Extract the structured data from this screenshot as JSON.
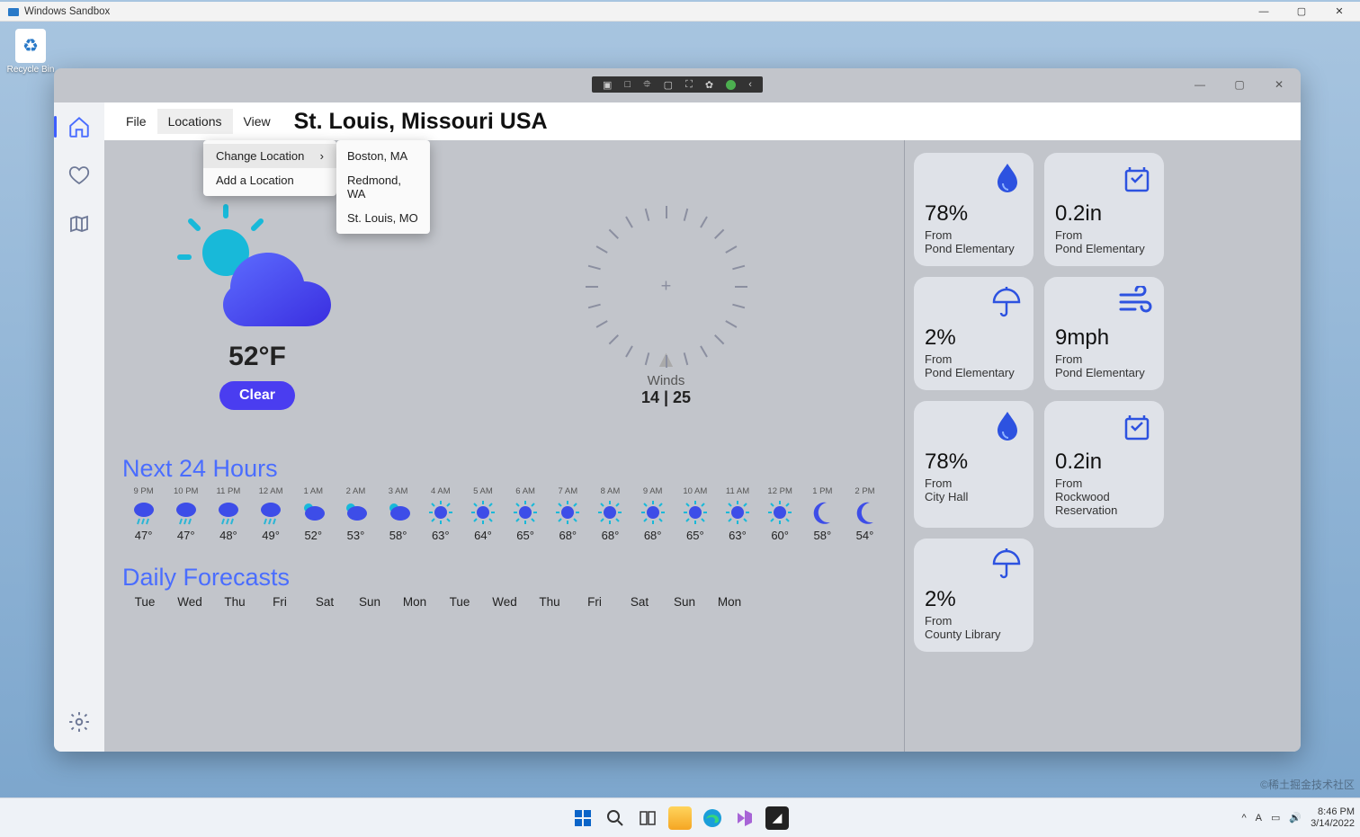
{
  "sandbox": {
    "title": "Windows Sandbox"
  },
  "desktop": {
    "recycle_bin": "Recycle Bin"
  },
  "app": {
    "menu": {
      "file": "File",
      "locations": "Locations",
      "view": "View"
    },
    "title": "St. Louis, Missouri USA",
    "loc_menu": {
      "change": "Change Location",
      "add": "Add a Location"
    },
    "loc_options": [
      "Boston, MA",
      "Redmond, WA",
      "St. Louis, MO"
    ],
    "current": {
      "temp": "52°F",
      "condition": "Clear",
      "winds_label": "Winds",
      "winds_vals": "14 | 25"
    },
    "next24_title": "Next 24 Hours",
    "hourly": [
      {
        "time": "9 PM",
        "temp": "47°",
        "icon": "rain"
      },
      {
        "time": "10 PM",
        "temp": "47°",
        "icon": "rain"
      },
      {
        "time": "11 PM",
        "temp": "48°",
        "icon": "rain"
      },
      {
        "time": "12 AM",
        "temp": "49°",
        "icon": "rain"
      },
      {
        "time": "1 AM",
        "temp": "52°",
        "icon": "cloudy"
      },
      {
        "time": "2 AM",
        "temp": "53°",
        "icon": "cloudy"
      },
      {
        "time": "3 AM",
        "temp": "58°",
        "icon": "cloudy"
      },
      {
        "time": "4 AM",
        "temp": "63°",
        "icon": "sun"
      },
      {
        "time": "5 AM",
        "temp": "64°",
        "icon": "sun"
      },
      {
        "time": "6 AM",
        "temp": "65°",
        "icon": "sun"
      },
      {
        "time": "7 AM",
        "temp": "68°",
        "icon": "sun"
      },
      {
        "time": "8 AM",
        "temp": "68°",
        "icon": "sun"
      },
      {
        "time": "9 AM",
        "temp": "68°",
        "icon": "sun"
      },
      {
        "time": "10 AM",
        "temp": "65°",
        "icon": "sun"
      },
      {
        "time": "11 AM",
        "temp": "63°",
        "icon": "sun"
      },
      {
        "time": "12 PM",
        "temp": "60°",
        "icon": "sun"
      },
      {
        "time": "1 PM",
        "temp": "58°",
        "icon": "moon"
      },
      {
        "time": "2 PM",
        "temp": "54°",
        "icon": "moon"
      }
    ],
    "daily_title": "Daily Forecasts",
    "daily": [
      "Tue",
      "Wed",
      "Thu",
      "Fri",
      "Sat",
      "Sun",
      "Mon",
      "Tue",
      "Wed",
      "Thu",
      "Fri",
      "Sat",
      "Sun",
      "Mon"
    ],
    "tiles": [
      {
        "icon": "drop",
        "val": "78%",
        "from": "From",
        "loc": "Pond Elementary"
      },
      {
        "icon": "gauge",
        "val": "0.2in",
        "from": "From",
        "loc": "Pond Elementary"
      },
      {
        "icon": "umbrella",
        "val": "2%",
        "from": "From",
        "loc": "Pond Elementary"
      },
      {
        "icon": "wind",
        "val": "9mph",
        "from": "From",
        "loc": "Pond Elementary"
      },
      {
        "icon": "drop",
        "val": "78%",
        "from": "From",
        "loc": "City Hall"
      },
      {
        "icon": "gauge",
        "val": "0.2in",
        "from": "From",
        "loc": "Rockwood Reservation"
      },
      {
        "icon": "umbrella",
        "val": "2%",
        "from": "From",
        "loc": "County Library"
      }
    ]
  },
  "taskbar": {
    "time": "8:46 PM",
    "date": "3/14/2022"
  },
  "watermark": "©稀土掘金技术社区"
}
